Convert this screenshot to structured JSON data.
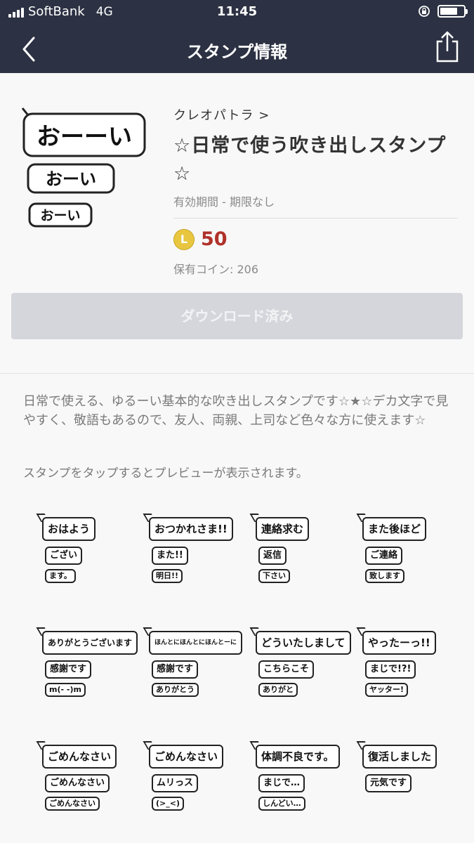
{
  "status_bar": {
    "carrier": "SoftBank",
    "network": "4G",
    "time": "11:45",
    "battery_level": 0.75
  },
  "nav": {
    "title": "スタンプ情報"
  },
  "pack": {
    "author": "クレオパトラ >",
    "title": "☆日常で使う吹き出しスタンプ☆",
    "validity": "有効期間 - 期限なし",
    "coin_symbol": "L",
    "price": "50",
    "owned_coins": "保有コイン: 206",
    "download_label": "ダウンロード済み",
    "main_sticker": [
      "おーーい",
      "おーい",
      "おーい"
    ]
  },
  "description": "日常で使える、ゆるーい基本的な吹き出しスタンプです☆★☆デカ文字で見やすく、敬語もあるので、友人、両親、上司など色々な方に使えます☆",
  "preview_hint": "スタンプをタップするとプレビューが表示されます。",
  "stickers": [
    {
      "lines": [
        "おはよう",
        "ござい",
        "ます。"
      ]
    },
    {
      "lines": [
        "おつかれさま!!",
        "また!!",
        "明日!!"
      ]
    },
    {
      "lines": [
        "連絡求む",
        "返信",
        "下さい"
      ]
    },
    {
      "lines": [
        "また後ほど",
        "ご連絡",
        "致します"
      ]
    },
    {
      "lines": [
        "ありがとうございます",
        "感謝です",
        "m(- -)m"
      ]
    },
    {
      "lines": [
        "ほんとにほんとにほんとーに",
        "感謝です",
        "ありがとう"
      ]
    },
    {
      "lines": [
        "どういたしまして",
        "こちらこそ",
        "ありがと"
      ]
    },
    {
      "lines": [
        "やったーっ!!",
        "まじで!?!",
        "ヤッター!"
      ]
    },
    {
      "lines": [
        "ごめんなさい",
        "ごめんなさい",
        "ごめんなさい"
      ]
    },
    {
      "lines": [
        "ごめんなさい",
        "ムリっス",
        "(>_<)"
      ]
    },
    {
      "lines": [
        "体調不良です。",
        "まじで…",
        "しんどい…"
      ]
    },
    {
      "lines": [
        "復活しました",
        "元気です"
      ]
    }
  ]
}
